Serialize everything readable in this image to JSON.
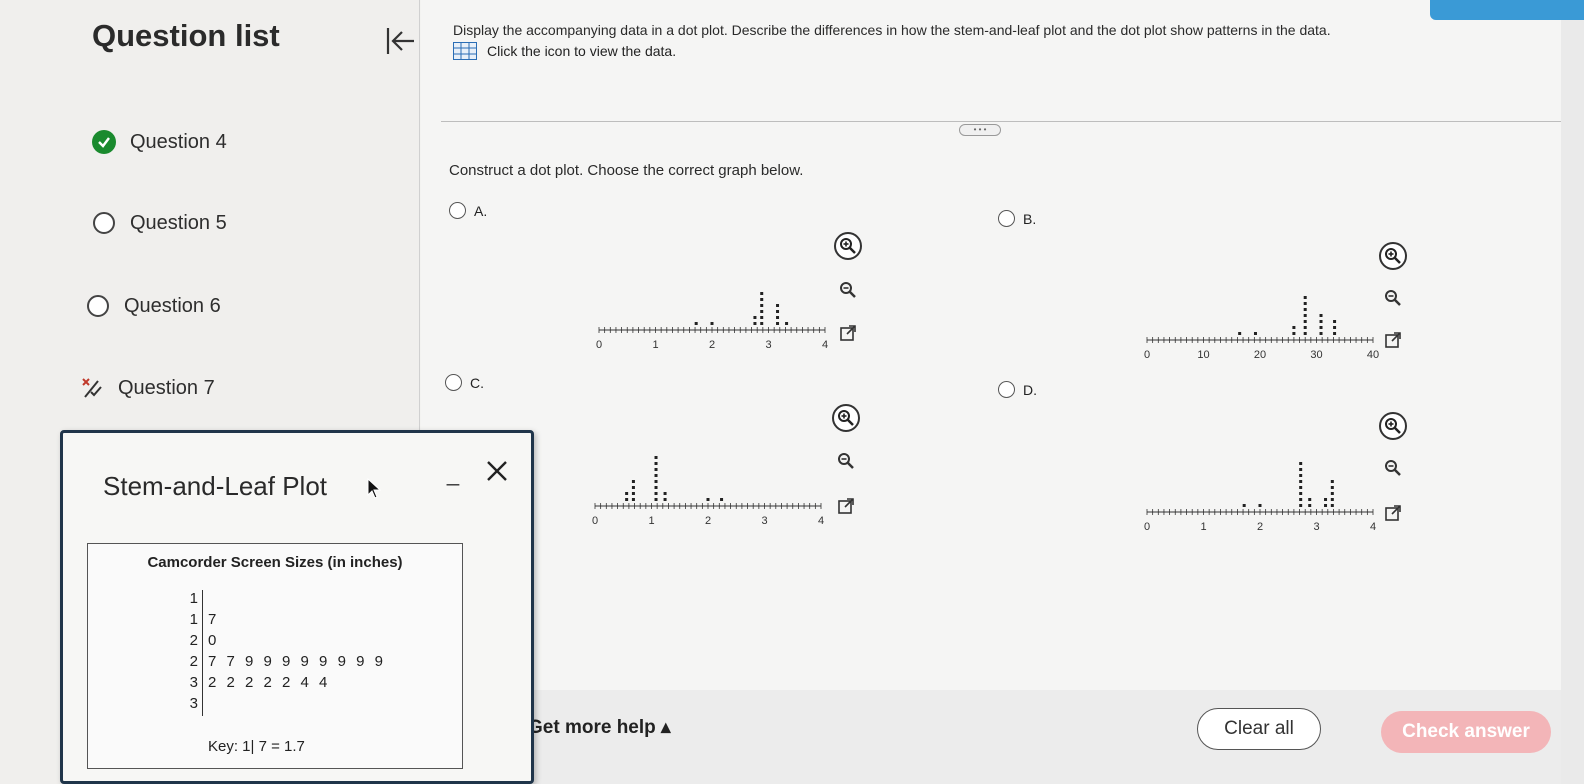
{
  "sidebar": {
    "title": "Question list",
    "questions": [
      {
        "label": "Question 4",
        "status": "correct"
      },
      {
        "label": "Question 5",
        "status": "unanswered"
      },
      {
        "label": "Question 6",
        "status": "unanswered"
      },
      {
        "label": "Question 7",
        "status": "partial"
      }
    ]
  },
  "main": {
    "prompt": "Display the accompanying data in a dot plot. Describe the differences in how the stem-and-leaf plot and the dot plot show patterns in the data.",
    "data_link": "Click the icon to view the data.",
    "instruction": "Construct a dot plot. Choose the correct graph below.",
    "options": [
      {
        "letter": "A.",
        "ticks": [
          "0",
          "1",
          "2",
          "3",
          "4"
        ]
      },
      {
        "letter": "B.",
        "ticks": [
          "0",
          "10",
          "20",
          "30",
          "40"
        ]
      },
      {
        "letter": "C.",
        "ticks": [
          "0",
          "1",
          "2",
          "3",
          "4"
        ]
      },
      {
        "letter": "D.",
        "ticks": [
          "0",
          "1",
          "2",
          "3",
          "4"
        ]
      }
    ]
  },
  "popup": {
    "title": "Stem-and-Leaf Plot",
    "minimize": "_",
    "table_title": "Camcorder Screen Sizes (in inches)",
    "rows": [
      {
        "stem": "1",
        "leaves": ""
      },
      {
        "stem": "1",
        "leaves": "7"
      },
      {
        "stem": "2",
        "leaves": "0"
      },
      {
        "stem": "2",
        "leaves": "7 7 9 9 9 9 9 9 9 9"
      },
      {
        "stem": "3",
        "leaves": "2 2 2 2 2 4 4"
      },
      {
        "stem": "3",
        "leaves": ""
      }
    ],
    "key": "Key: 1| 7 = 1.7"
  },
  "bottom": {
    "help": "Get more help ▴",
    "clear": "Clear all",
    "check": "Check answer"
  },
  "colors": {
    "correct_green": "#1a8a2e",
    "check_button": "#f3b5b8",
    "popup_border": "#20354a"
  }
}
